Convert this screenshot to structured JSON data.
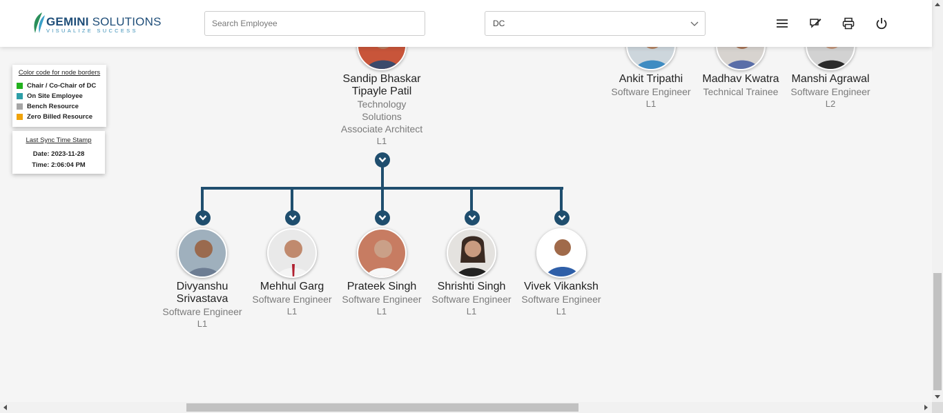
{
  "brand": {
    "name_bold": "GEMINI",
    "name_rest": " SOLUTIONS",
    "tagline": "VISUALIZE SUCCESS",
    "accent": "#1f4e79"
  },
  "search": {
    "placeholder": "Search Employee",
    "value": ""
  },
  "dept_select": {
    "value": "DC"
  },
  "header_icons": [
    "menu-icon",
    "feedback-edit-icon",
    "print-icon",
    "power-icon"
  ],
  "legend": {
    "title": "Color code for node borders",
    "items": [
      {
        "label": "Chair / Co-Chair of DC",
        "color": "#22b11e"
      },
      {
        "label": "On Site Employee",
        "color": "#2e9fa8"
      },
      {
        "label": "Bench Resource",
        "color": "#a6a6a6"
      },
      {
        "label": "Zero Billed Resource",
        "color": "#f0a30a"
      }
    ]
  },
  "sync": {
    "title": "Last Sync Time Stamp",
    "date": "Date: 2023-11-28",
    "time": "Time: 2:06:04 PM"
  },
  "top_nodes": [
    {
      "name1": "Sandip Bhaskar",
      "name2": "Tipayle Patil",
      "d1": "Technology",
      "d2": "Solutions",
      "d3": "Associate Architect",
      "level": "L1"
    },
    {
      "name1": "Ankit Tripathi",
      "d1": "Software Engineer",
      "level": "L1"
    },
    {
      "name1": "Madhav Kwatra",
      "d1": "Technical Trainee",
      "level": ""
    },
    {
      "name1": "Manshi Agrawal",
      "d1": "Software Engineer",
      "level": "L2"
    }
  ],
  "children": [
    {
      "name1": "Divyanshu",
      "name2": "Srivastava",
      "designation": "Software Engineer",
      "level": "L1"
    },
    {
      "name1": "Mehhul Garg",
      "designation": "Software Engineer",
      "level": "L1"
    },
    {
      "name1": "Prateek Singh",
      "designation": "Software Engineer",
      "level": "L1"
    },
    {
      "name1": "Shrishti Singh",
      "designation": "Software Engineer",
      "level": "L1"
    },
    {
      "name1": "Vivek Vikanksh",
      "designation": "Software Engineer",
      "level": "L1"
    }
  ],
  "connector_color": "#1f4e6e"
}
